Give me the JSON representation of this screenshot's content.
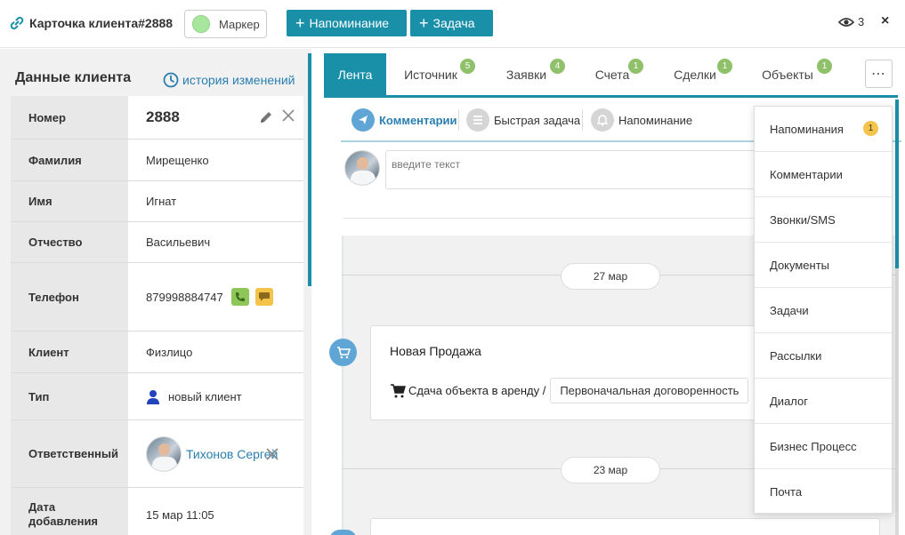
{
  "header": {
    "title": "Карточка клиента#2888",
    "marker_label": "Маркер",
    "reminder_button": "Напоминание",
    "task_button": "Задача",
    "plus_glyph": "+",
    "viewers_count": "3",
    "close_glyph": "×"
  },
  "client": {
    "title": "Данные клиента",
    "history_link": "история изменений",
    "fields": {
      "number": {
        "label": "Номер",
        "value": "2888"
      },
      "surname": {
        "label": "Фамилия",
        "value": "Мирещенко"
      },
      "name": {
        "label": "Имя",
        "value": "Игнат"
      },
      "patronymic": {
        "label": "Отчество",
        "value": "Васильевич"
      },
      "phone": {
        "label": "Телефон",
        "value": "879998884747"
      },
      "client_type": {
        "label": "Клиент",
        "value": "Физлицо"
      },
      "type": {
        "label": "Тип",
        "value": "новый клиент"
      },
      "responsible": {
        "label": "Ответственный",
        "value": "Тихонов Сергей"
      },
      "date_added": {
        "label": "Дата добавления",
        "value": "15 мар 11:05"
      }
    },
    "clear_glyph": "×"
  },
  "tabs": [
    {
      "label": "Лента",
      "badge": ""
    },
    {
      "label": "Источник",
      "badge": "5"
    },
    {
      "label": "Заявки",
      "badge": "4"
    },
    {
      "label": "Счета",
      "badge": "1"
    },
    {
      "label": "Сделки",
      "badge": "1"
    },
    {
      "label": "Объекты",
      "badge": "1"
    }
  ],
  "more_glyph": "⋯",
  "subtabs": {
    "comments": "Комментарии",
    "quick_task": "Быстрая задача",
    "reminder": "Напоминание"
  },
  "comment_placeholder": "введите текст",
  "feed": {
    "date1": "27 мар",
    "date2": "23 мар",
    "sale_title": "Новая Продажа",
    "sale_path": "Сдача объекта в аренду /",
    "sale_stage": "Первоначальная договоренность"
  },
  "dropdown": [
    {
      "label": "Напоминания",
      "badge": "1"
    },
    {
      "label": "Комментарии"
    },
    {
      "label": "Звонки/SMS"
    },
    {
      "label": "Документы"
    },
    {
      "label": "Задачи"
    },
    {
      "label": "Рассылки"
    },
    {
      "label": "Диалог"
    },
    {
      "label": "Бизнес Процесс"
    },
    {
      "label": "Почта"
    }
  ],
  "colors": {
    "accent": "#1a8fa8",
    "badge_green": "#8fc06a",
    "badge_yellow": "#f4c34a",
    "link": "#2a7fb0"
  }
}
